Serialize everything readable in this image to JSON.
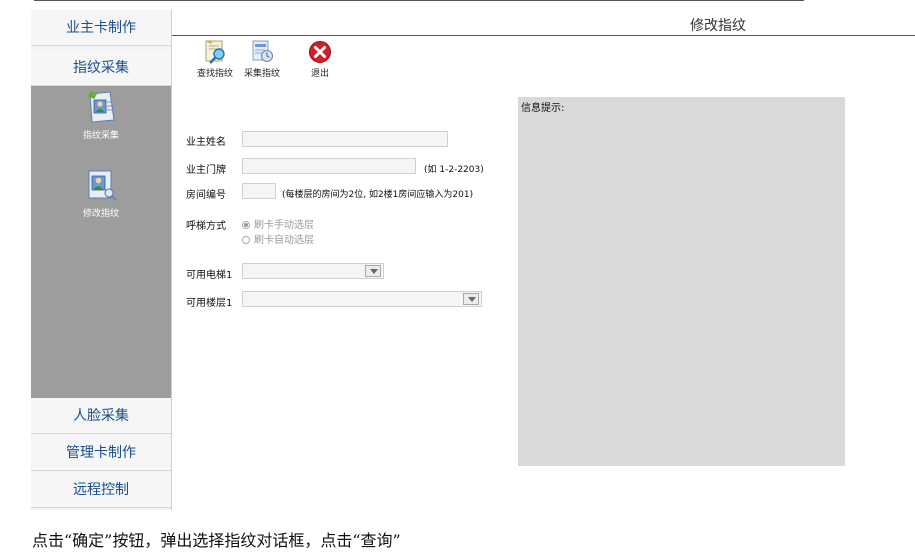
{
  "sidebar": {
    "items": [
      {
        "label": "业主卡制作"
      },
      {
        "label": "指纹采集"
      },
      {
        "label": "人脸采集"
      },
      {
        "label": "管理卡制作"
      },
      {
        "label": "远程控制"
      }
    ],
    "sub_items": [
      {
        "label": "指纹采集",
        "icon": "fingerprint-collect-icon"
      },
      {
        "label": "修改指纹",
        "icon": "fingerprint-edit-icon"
      }
    ]
  },
  "main": {
    "title": "修改指纹",
    "toolbar": [
      {
        "label": "查找指纹",
        "icon": "search-fingerprint-icon"
      },
      {
        "label": "采集指纹",
        "icon": "collect-fingerprint-icon"
      },
      {
        "label": "退出",
        "icon": "exit-icon"
      }
    ],
    "info_label": "信息提示:",
    "form": {
      "owner_name_label": "业主姓名",
      "owner_name_value": "",
      "door_label": "业主门牌",
      "door_value": "",
      "door_hint": "(如 1-2-2203)",
      "room_label": "房间编号",
      "room_value": "",
      "room_hint": "(每楼层的房间为2位, 如2楼1房间应输入为201)",
      "elevator_mode_label": "呼梯方式",
      "elevator_mode_options": [
        "刷卡手动选层",
        "刷卡自动选层"
      ],
      "elevator_mode_selected": 0,
      "elevator_label": "可用电梯1",
      "elevator_value": "",
      "floor_label": "可用楼层1",
      "floor_value": ""
    }
  },
  "caption": "点击“确定”按钮，弹出选择指纹对话框，点击“查询”",
  "colors": {
    "nav_text": "#1a4d8f",
    "sub_panel": "#9d9d9d",
    "info_panel": "#d9d9d9",
    "exit_red": "#d0202a"
  }
}
